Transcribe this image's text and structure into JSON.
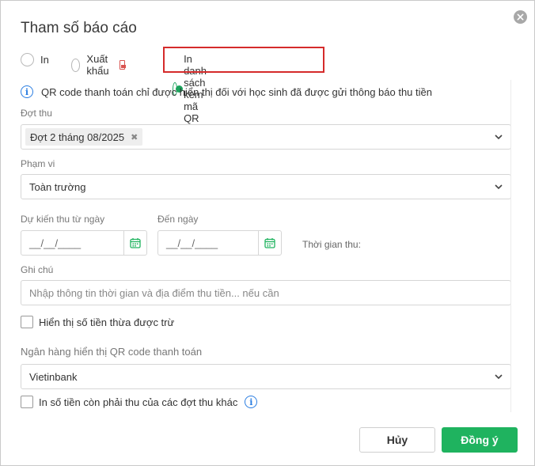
{
  "dialog": {
    "title": "Tham số báo cáo"
  },
  "options": {
    "print": "In",
    "export": "Xuất khẩu",
    "print_qr": "In danh sách kèm mã QR",
    "selected": "print_qr"
  },
  "info_text": "QR code thanh toán chỉ được hiển thị đối với học sinh đã được gửi thông báo thu tiền",
  "fields": {
    "collection_round": {
      "label": "Đợt thu",
      "tag": "Đợt 2 tháng 08/2025"
    },
    "scope": {
      "label": "Phạm vi",
      "value": "Toàn trường"
    },
    "from_date": {
      "label": "Dự kiến thu từ ngày",
      "value": "__/__/____"
    },
    "to_date": {
      "label": "Đến ngày",
      "value": "__/__/____"
    },
    "collection_time_label": "Thời gian thu:",
    "note": {
      "label": "Ghi chú",
      "placeholder": "Nhập thông tin thời gian và địa điểm thu tiền... nếu cần"
    },
    "show_excess": "Hiển thị số tiền thừa được trừ",
    "bank": {
      "label": "Ngân hàng hiển thị QR code thanh toán",
      "value": "Vietinbank"
    },
    "print_other_due": "In số tiền còn phải thu của các đợt thu khác"
  },
  "buttons": {
    "cancel": "Hủy",
    "ok": "Đồng ý"
  },
  "colors": {
    "accent": "#1fb35f",
    "info": "#2a7de1",
    "highlight": "#d52b2b"
  }
}
